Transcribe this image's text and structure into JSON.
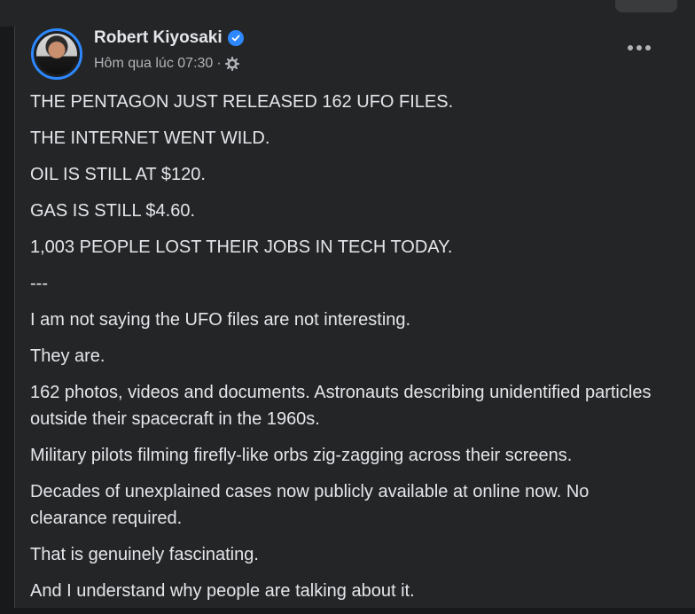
{
  "post": {
    "author": "Robert Kiyosaki",
    "timestamp": "Hôm qua lúc 07:30",
    "separator": "·",
    "paragraphs": [
      "THE PENTAGON JUST RELEASED 162 UFO FILES.",
      "THE INTERNET WENT WILD.",
      "OIL IS STILL AT $120.",
      "GAS IS STILL $4.60.",
      "1,003 PEOPLE LOST THEIR JOBS IN TECH TODAY.",
      "---",
      "I am not saying the UFO files are not interesting.",
      "They are.",
      "162 photos, videos and documents. Astronauts describing unidentified particles outside their spacecraft in the 1960s.",
      "Military pilots filming firefly-like orbs zig-zagging across their screens.",
      "Decades of unexplained cases now publicly available at online now. No clearance required.",
      "That is genuinely fascinating.",
      "And I understand why people are talking about it."
    ]
  },
  "icons": {
    "verified": "verified-badge-icon",
    "audience": "gear-icon",
    "more": "more-options-icon"
  },
  "colors": {
    "background": "#18191a",
    "card": "#242526",
    "text": "#e4e6eb",
    "secondary_text": "#b0b3b8",
    "accent": "#2d88ff"
  }
}
